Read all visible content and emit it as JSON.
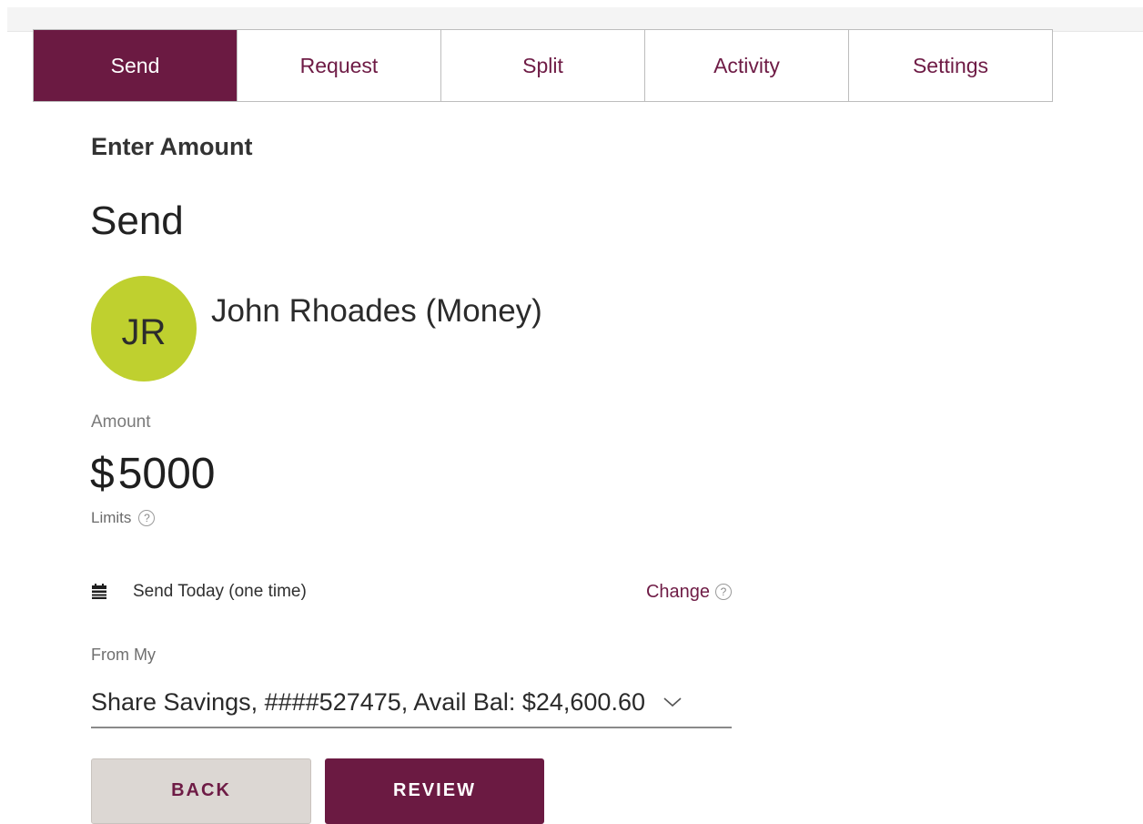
{
  "tabs": [
    {
      "label": "Send",
      "active": true
    },
    {
      "label": "Request",
      "active": false
    },
    {
      "label": "Split",
      "active": false
    },
    {
      "label": "Activity",
      "active": false
    },
    {
      "label": "Settings",
      "active": false
    }
  ],
  "page": {
    "section_title": "Enter Amount",
    "heading": "Send"
  },
  "recipient": {
    "initials": "JR",
    "name": "John Rhoades (Money)",
    "avatar_color": "#bfd02f"
  },
  "amount": {
    "label": "Amount",
    "currency_symbol": "$",
    "value": "5000",
    "limits_label": "Limits"
  },
  "schedule": {
    "icon": "calendar-icon",
    "text": "Send Today (one time)",
    "change_label": "Change"
  },
  "from_account": {
    "label": "From My",
    "selected": "Share Savings, ####527475, Avail Bal: $24,600.60"
  },
  "buttons": {
    "back": "BACK",
    "review": "REVIEW"
  },
  "colors": {
    "brand": "#6b1a42",
    "avatar": "#bfd02f",
    "back_button": "#dcd7d3"
  },
  "help_glyph": "?"
}
